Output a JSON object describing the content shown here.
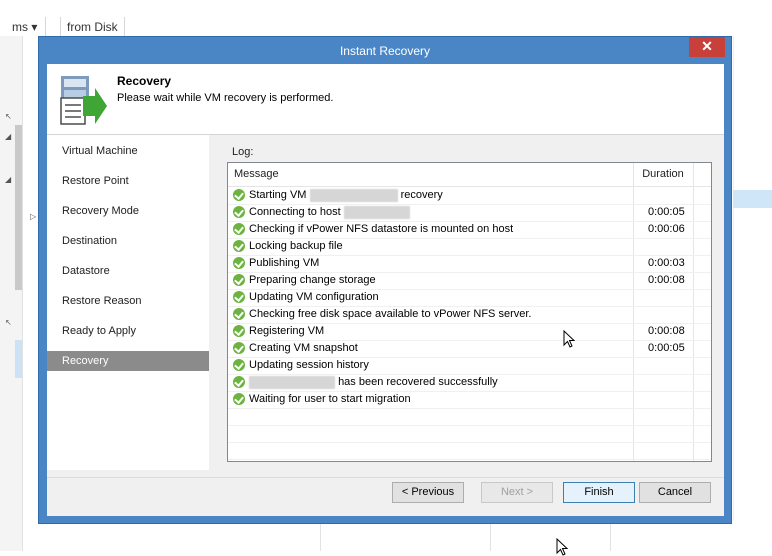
{
  "background": {
    "tab1": "ms ▾",
    "tab2": "from Disk"
  },
  "dialog": {
    "title": "Instant Recovery",
    "close_glyph": "✕",
    "header": {
      "title": "Recovery",
      "subtitle": "Please wait while VM recovery is performed."
    },
    "nav": [
      {
        "label": "Virtual Machine",
        "active": false
      },
      {
        "label": "Restore Point",
        "active": false
      },
      {
        "label": "Recovery Mode",
        "active": false
      },
      {
        "label": "Destination",
        "active": false
      },
      {
        "label": "Datastore",
        "active": false
      },
      {
        "label": "Restore Reason",
        "active": false
      },
      {
        "label": "Ready to Apply",
        "active": false
      },
      {
        "label": "Recovery",
        "active": true
      }
    ],
    "log": {
      "label": "Log:",
      "columns": {
        "message": "Message",
        "duration": "Duration"
      },
      "rows": [
        {
          "pre": "Starting VM",
          "post": "recovery",
          "duration": ""
        },
        {
          "pre": "Connecting to host",
          "post": "",
          "duration": "0:00:05"
        },
        {
          "pre": "Checking if vPower NFS datastore is mounted on host",
          "post": "",
          "duration": "0:00:06"
        },
        {
          "pre": "Locking backup file",
          "post": "",
          "duration": ""
        },
        {
          "pre": "Publishing VM",
          "post": "",
          "duration": "0:00:03"
        },
        {
          "pre": "Preparing change storage",
          "post": "",
          "duration": "0:00:08"
        },
        {
          "pre": "Updating VM configuration",
          "post": "",
          "duration": ""
        },
        {
          "pre": "Checking free disk space available to vPower NFS server.",
          "post": "",
          "duration": ""
        },
        {
          "pre": "Registering VM",
          "post": "",
          "duration": "0:00:08"
        },
        {
          "pre": "Creating VM snapshot",
          "post": "",
          "duration": "0:00:05"
        },
        {
          "pre": "Updating session history",
          "post": "",
          "duration": ""
        },
        {
          "pre": "",
          "post": "has been recovered successfully",
          "duration": ""
        },
        {
          "pre": "Waiting for user to start migration",
          "post": "",
          "duration": ""
        }
      ]
    },
    "buttons": {
      "previous": "< Previous",
      "next": "Next >",
      "finish": "Finish",
      "cancel": "Cancel"
    }
  },
  "colors": {
    "window_border": "#4a86c6",
    "close": "#c7403a",
    "success": "#6cb33f",
    "nav_active": "#8b8b8b"
  }
}
